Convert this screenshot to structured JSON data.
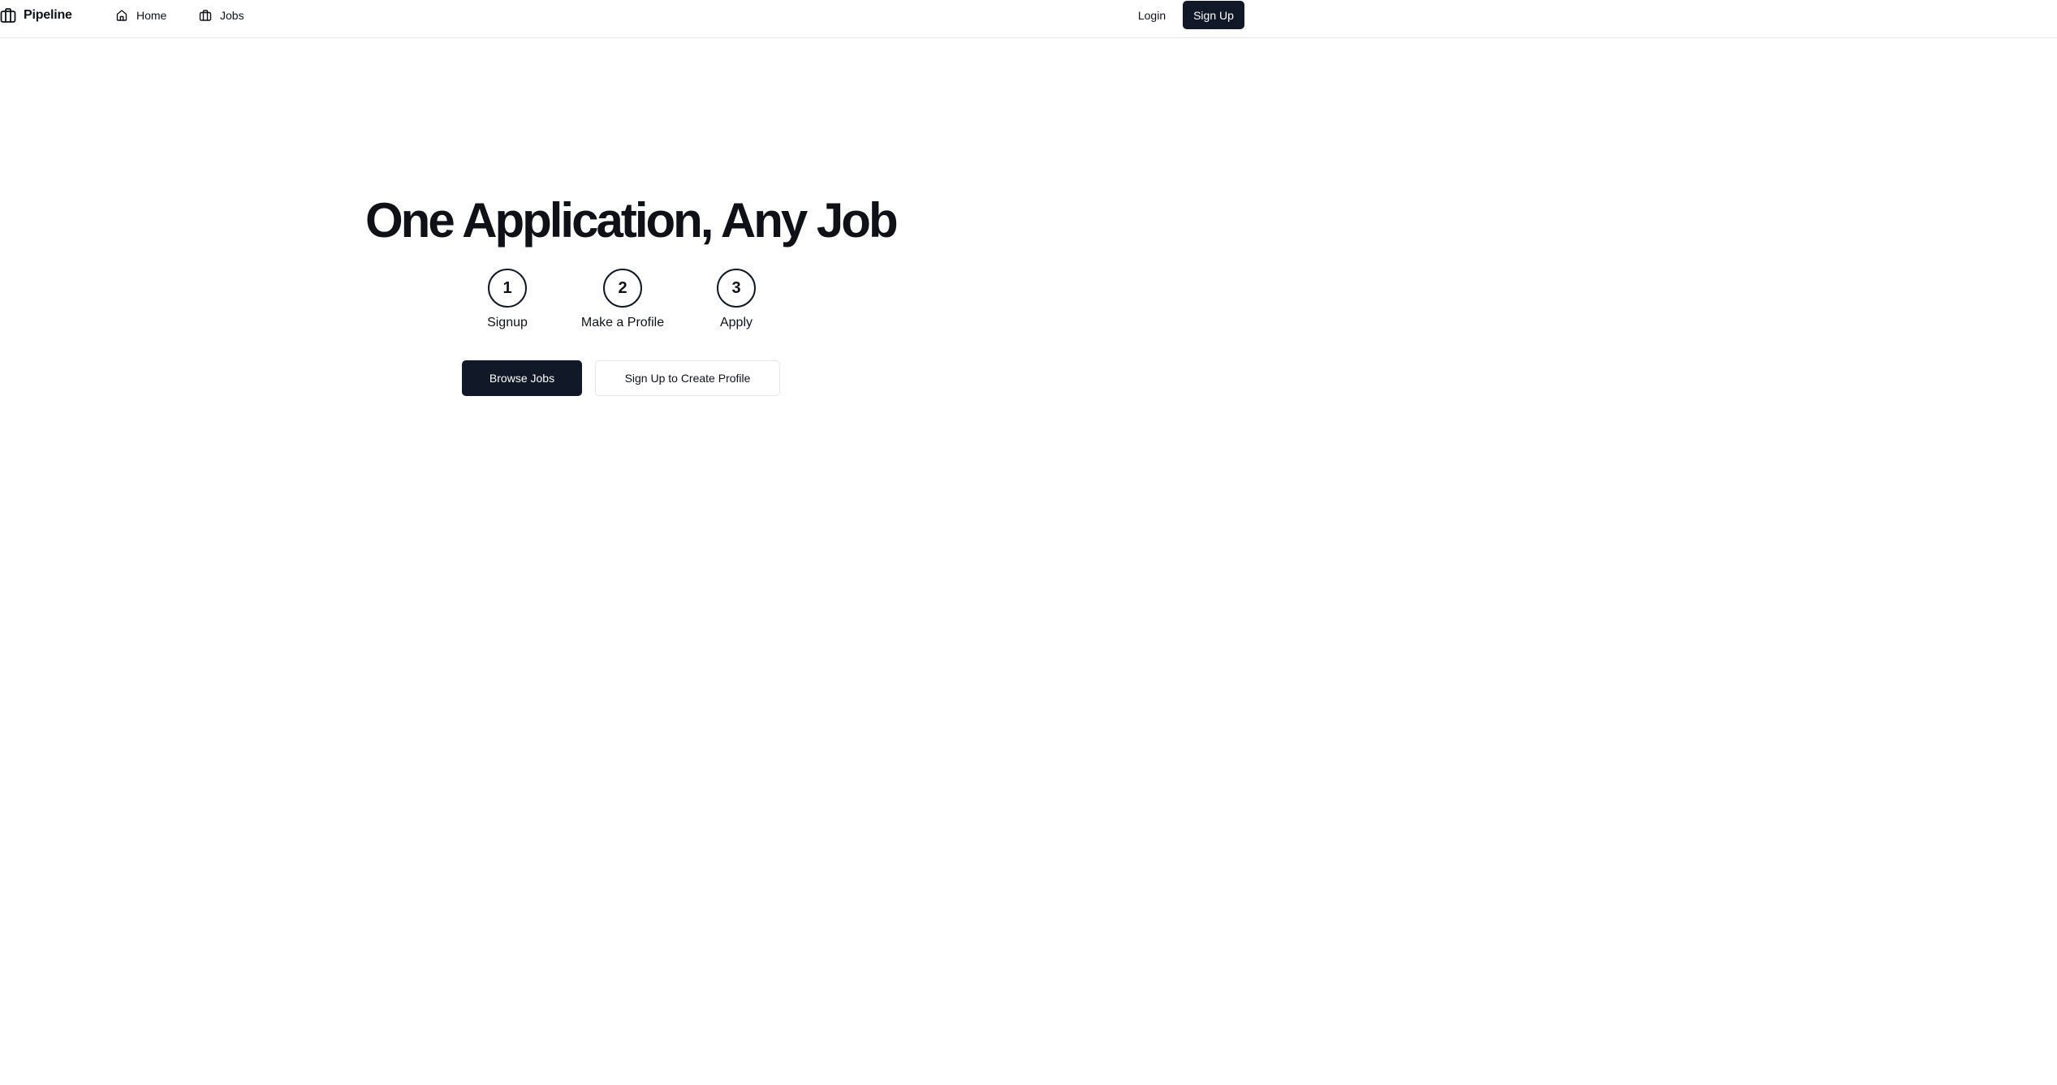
{
  "header": {
    "brand": {
      "name": "Pipeline",
      "icon": "briefcase-icon"
    },
    "nav": [
      {
        "label": "Home",
        "icon": "home-icon"
      },
      {
        "label": "Jobs",
        "icon": "briefcase-icon"
      }
    ],
    "login_label": "Login",
    "signup_label": "Sign Up"
  },
  "hero": {
    "title": "One Application, Any Job",
    "steps": [
      {
        "number": "1",
        "label": "Signup"
      },
      {
        "number": "2",
        "label": "Make a Profile"
      },
      {
        "number": "3",
        "label": "Apply"
      }
    ],
    "primary_button": "Browse Jobs",
    "secondary_button": "Sign Up to Create Profile"
  },
  "colors": {
    "primary": "#111827",
    "text": "#0f1117",
    "border": "#e5e7eb",
    "background": "#ffffff"
  }
}
